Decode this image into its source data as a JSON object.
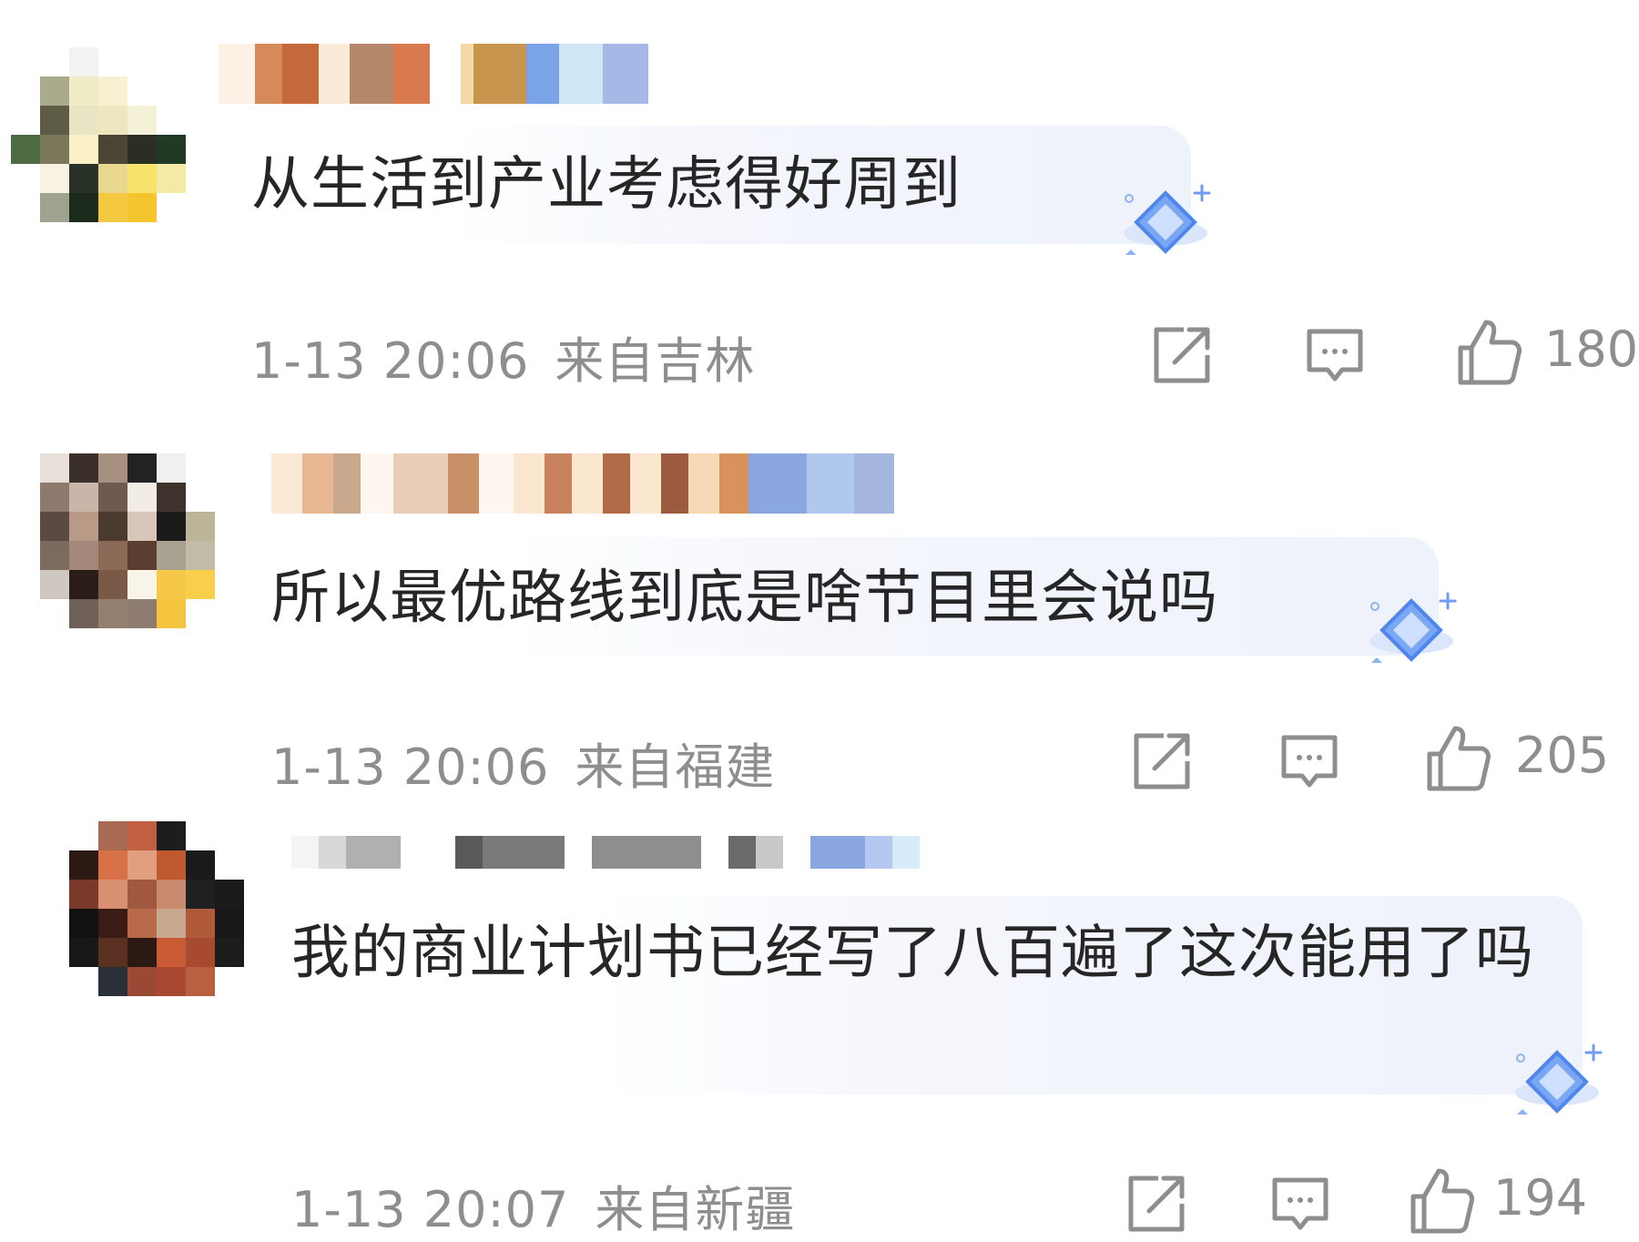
{
  "comments": [
    {
      "text": "从生活到产业考虑得好周到",
      "time": "1-13 20:06",
      "location": "来自吉林",
      "likes": "180",
      "avatar_colors": [
        "#ffffff",
        "#ffffff",
        "#f2f2f2",
        "#ffffff",
        "#ffffff",
        "#ffffff",
        "#ffffff",
        "#a9ab8c",
        "#f0ecc8",
        "#f7f1d2",
        "#ffffff",
        "#ffffff",
        "#ffffff",
        "#5f5c45",
        "#e9e4c4",
        "#efe6bf",
        "#f5f0d8",
        "#ffffff",
        "#4e6b41",
        "#7c785c",
        "#fbf1c8",
        "#4b4535",
        "#2a2e25",
        "#1f3b26",
        "#ffffff",
        "#f7f2e2",
        "#293226",
        "#e8d88f",
        "#f8e36d",
        "#f5e9a8",
        "#ffffff",
        "#9ea38f",
        "#1c2a1c",
        "#f5c842",
        "#f4c52e",
        "#ffffff"
      ],
      "name_colors": [
        "#fdf1e6",
        "#d68a5a",
        "#c46a3a",
        "#faebd9",
        "#b5876a",
        "#d87a4e",
        "#ffffff",
        "#f3d9a8",
        "#c8954e",
        "#7aa3e8",
        "#cfe6f7",
        "#a5b8e6"
      ]
    },
    {
      "text": "所以最优路线到底是啥节目里会说吗",
      "time": "1-13 20:06",
      "location": "来自福建",
      "likes": "205",
      "avatar_colors": [
        "#e7e0da",
        "#3a2f2a",
        "#a89080",
        "#222222",
        "#f0f0f0",
        "#ffffff",
        "#8e7a6c",
        "#c9b6a8",
        "#6e5a4f",
        "#f1ece6",
        "#3d322c",
        "#ffffff",
        "#5a4a42",
        "#b89a86",
        "#4a3a30",
        "#d8c6b8",
        "#1b1b1b",
        "#bcb59a",
        "#7d6a5e",
        "#a2877a",
        "#8b6a58",
        "#5a3f31",
        "#a9a290",
        "#c2bca6",
        "#cfc8c0",
        "#2a1d18",
        "#7a5a46",
        "#f8f4e8",
        "#f5c947",
        "#f7cf4a",
        "#ffffff",
        "#6f6058",
        "#948070",
        "#8e7c70",
        "#f4c43c",
        "#ffffff"
      ],
      "name_colors": [
        "#fbe9d6",
        "#e8b894",
        "#c9a88e",
        "#fdf7f0",
        "#e9cdb6",
        "#c98f66",
        "#fdf7f0",
        "#fbe6d0",
        "#c8835e",
        "#fbe6d0",
        "#b06a46",
        "#fbe6d0",
        "#9c5a40",
        "#f7d9b8",
        "#d8935c",
        "#8aa7e0",
        "#b0c8ec",
        "#a4b5de"
      ]
    },
    {
      "text": "我的商业计划书已经写了八百遍了这次能用了吗",
      "time": "1-13 20:07",
      "location": "来自新疆",
      "likes": "194",
      "avatar_colors": [
        "#ffffff",
        "#a86a52",
        "#c06040",
        "#1d1d1d",
        "#ffffff",
        "#ffffff",
        "#2a1a12",
        "#d87048",
        "#e0a080",
        "#c05830",
        "#1a1a1a",
        "#ffffff",
        "#7a3a2a",
        "#d89070",
        "#a05840",
        "#c88a6e",
        "#202020",
        "#1a1a1a",
        "#111111",
        "#3b1c14",
        "#b86a4a",
        "#c8a890",
        "#b05a3a",
        "#181818",
        "#181818",
        "#5a3020",
        "#2a1a12",
        "#c85a34",
        "#a84a30",
        "#1c1c1c",
        "#ffffff",
        "#2a3038",
        "#9a4a34",
        "#a84830",
        "#b86040",
        "#ffffff"
      ],
      "name_colors": [
        "#f4f4f4",
        "#d8d8d8",
        "#b0b0b0",
        "#ffffff",
        "#5a5a5a",
        "#7a7a7a",
        "#ffffff",
        "#8e8e8e",
        "#ffffff",
        "#6a6a6a",
        "#c8c8c8",
        "#ffffff",
        "#8aa7e0",
        "#b5c8f0",
        "#d6ecf8"
      ]
    }
  ],
  "icons": {
    "share": "share-icon",
    "reply": "comment-icon",
    "like": "thumbs-up-icon",
    "badge": "diamond-badge-icon"
  },
  "colors": {
    "text": "#262626",
    "meta": "#8e8e8e",
    "bubble": "#eef2fb",
    "gem": "#6f9cf0"
  }
}
